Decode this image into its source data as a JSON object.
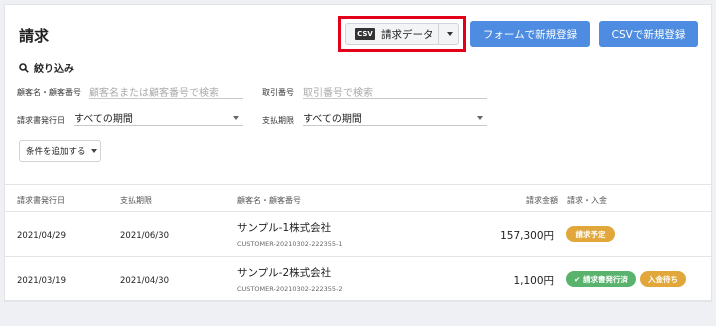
{
  "page": {
    "title": "請求"
  },
  "toolbar": {
    "csv_badge": "CSV",
    "csv_data_label": "請求データ",
    "form_register_label": "フォームで新規登録",
    "csv_register_label": "CSVで新規登録"
  },
  "filter": {
    "heading": "絞り込み",
    "customer_label": "顧客名・顧客番号",
    "customer_placeholder": "顧客名または顧客番号で検索",
    "trade_label": "取引番号",
    "trade_placeholder": "取引番号で検索",
    "issue_date_label": "請求書発行日",
    "issue_date_value": "すべての期間",
    "due_label": "支払期限",
    "due_value": "すべての期間",
    "add_condition_label": "条件を追加する"
  },
  "table": {
    "headers": {
      "issue_date": "請求書発行日",
      "due_date": "支払期限",
      "customer": "顧客名・顧客番号",
      "amount": "請求金額",
      "status": "請求・入金"
    },
    "rows": [
      {
        "issue_date": "2021/04/29",
        "due_date": "2021/06/30",
        "customer_name": "サンプル-1株式会社",
        "customer_code": "CUSTOMER-20210302-222355-1",
        "amount": "157,300円",
        "status1": "請求予定"
      },
      {
        "issue_date": "2021/03/19",
        "due_date": "2021/04/30",
        "customer_name": "サンプル-2株式会社",
        "customer_code": "CUSTOMER-20210302-222355-2",
        "amount": "1,100円",
        "status1": "✔ 請求書発行済",
        "status2": "入金待ち"
      }
    ]
  },
  "colors": {
    "highlight_border": "#e2001a",
    "primary_button": "#4d8ce0",
    "badge_orange": "#e2a73b",
    "badge_green": "#59b36d"
  }
}
